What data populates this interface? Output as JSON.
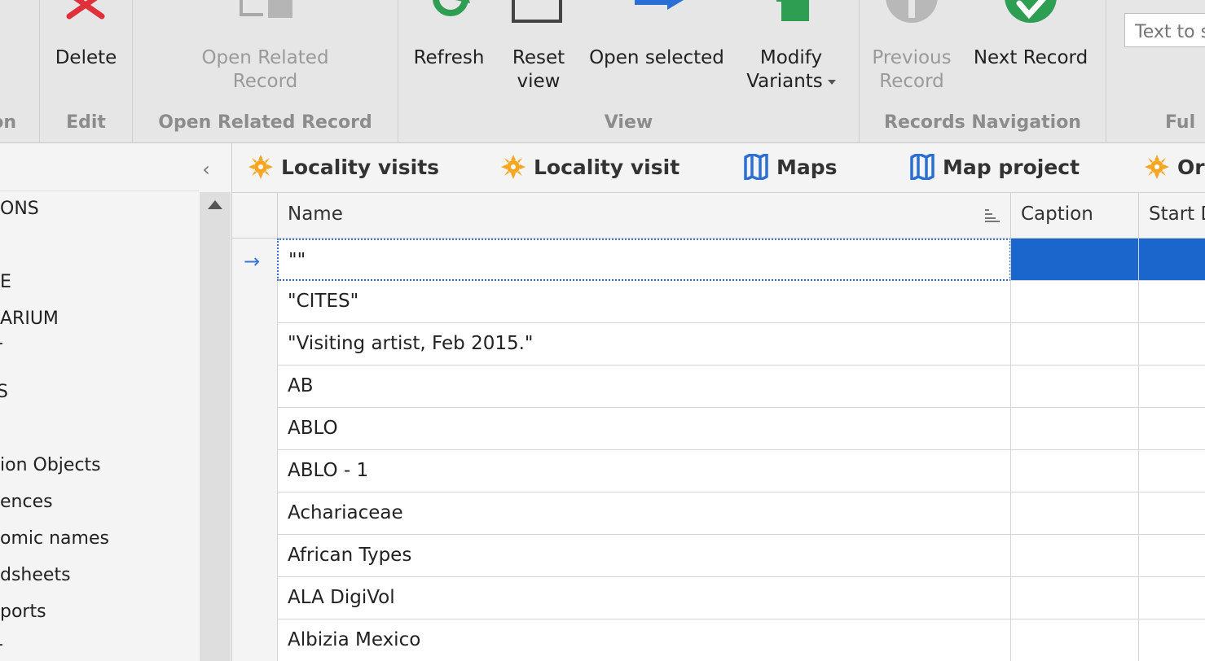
{
  "ribbon": {
    "groups": {
      "action": "on",
      "edit": "Edit",
      "open_related": "Open Related Record",
      "view": "View",
      "records_nav": "Records Navigation",
      "full": "Ful"
    },
    "buttons": {
      "delete": "Delete",
      "open_related_line1": "Open Related",
      "open_related_line2": "Record",
      "refresh": "Refresh",
      "reset_line1": "Reset",
      "reset_line2": "view",
      "open_selected": "Open selected",
      "modify_line1": "Modify",
      "modify_line2": "Variants",
      "prev_line1": "Previous",
      "prev_line2": "Record",
      "next_record": "Next Record"
    },
    "search_placeholder": "Text to s"
  },
  "nav": {
    "items": [
      "ONS",
      "E",
      "ARIUM",
      "-",
      "S",
      "ion Objects",
      "ences",
      "omic names",
      "dsheets",
      "ports",
      "-"
    ]
  },
  "tabs": [
    "Locality visits",
    "Locality visit",
    "Maps",
    "Map project",
    "Or"
  ],
  "grid": {
    "columns": [
      "Name",
      "Caption",
      "Start D"
    ],
    "rows": [
      "\"\"",
      "\"CITES\"",
      "\"Visiting artist, Feb 2015.\"",
      "AB",
      "ABLO",
      "ABLO - 1",
      "Achariaceae",
      "African Types",
      "ALA DigiVol",
      "Albizia Mexico"
    ],
    "focused_row": 0
  },
  "colors": {
    "selection": "#1a66cc",
    "accent_orange": "#f5a623",
    "map_blue": "#2a6fd6",
    "delete_red": "#e0303a",
    "green": "#2e9e52"
  }
}
